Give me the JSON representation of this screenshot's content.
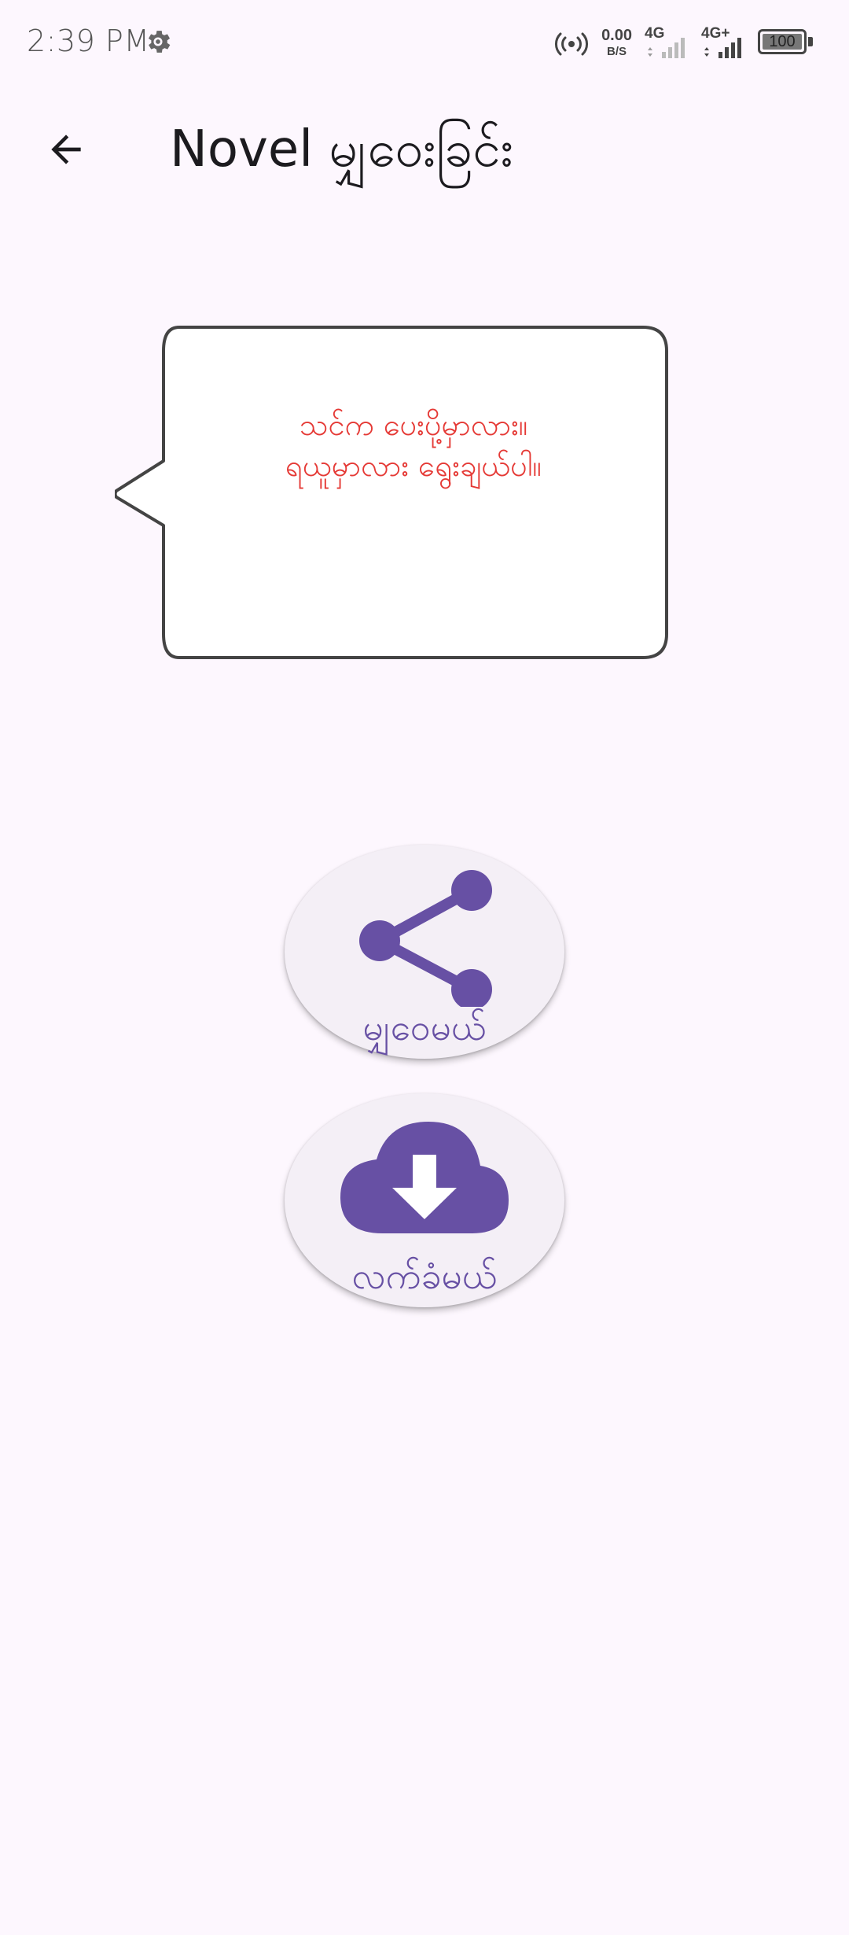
{
  "status_bar": {
    "time": "2:39 PM",
    "net_speed_value": "0.00",
    "net_speed_unit": "B/S",
    "sim1_label": "4G",
    "sim2_label": "4G+",
    "battery": "100",
    "icons": [
      "gear-icon",
      "hotspot-icon",
      "signal-icon",
      "battery-icon"
    ]
  },
  "app_bar": {
    "back_icon": "arrow-left-icon",
    "title": "Novel မျှဝေးခြင်း"
  },
  "bubble": {
    "line1": "သင်က ပေးပို့မှာလား။",
    "line2": "ရယူမှာလား ရွေးချယ်ပါ။"
  },
  "actions": {
    "share": {
      "label": "မျှဝေမယ်",
      "icon": "share-icon"
    },
    "download": {
      "label": "လက်ခံမယ်",
      "icon": "cloud-download-icon"
    }
  },
  "colors": {
    "background": "#fdf7fe",
    "accent": "#6750a4",
    "button_bg": "#f4eff6",
    "bubble_text": "#e53935",
    "bubble_border": "#444444"
  }
}
